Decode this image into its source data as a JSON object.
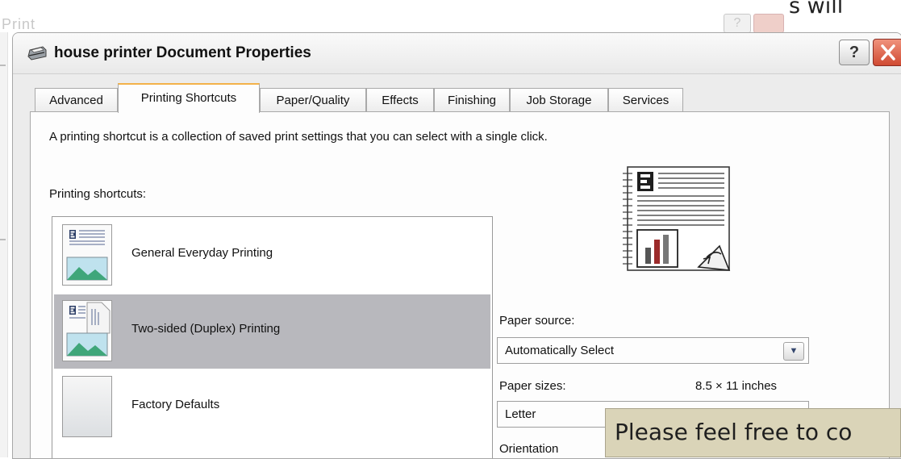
{
  "background_window": {
    "title_fragment": "Print",
    "help_label": "?",
    "right_text_fragment": "s will"
  },
  "dialog": {
    "title": "house printer Document Properties",
    "help_label": "?",
    "icon": "printer-icon"
  },
  "tabs": [
    {
      "label": "Advanced"
    },
    {
      "label": "Printing Shortcuts",
      "active": true
    },
    {
      "label": "Paper/Quality"
    },
    {
      "label": "Effects"
    },
    {
      "label": "Finishing"
    },
    {
      "label": "Job Storage"
    },
    {
      "label": "Services"
    }
  ],
  "panel": {
    "description": "A printing shortcut is a collection of saved print settings that you can select with a single click.",
    "shortcuts_label": "Printing shortcuts:",
    "shortcuts": [
      {
        "label": "General Everyday Printing",
        "icon": "document-landscape-icon",
        "selected": false
      },
      {
        "label": "Two-sided (Duplex) Printing",
        "icon": "duplex-document-icon",
        "selected": true
      },
      {
        "label": "Factory Defaults",
        "icon": "blank-page-icon",
        "selected": false
      }
    ],
    "preview_icon": "document-preview-icon",
    "paper_source": {
      "label": "Paper source:",
      "value": "Automatically Select"
    },
    "paper_sizes": {
      "label": "Paper sizes:",
      "size_text": "8.5 × 11 inches",
      "value": "Letter"
    },
    "orientation_label": "Orientation"
  },
  "overlay_caption": "Please feel free to co",
  "colors": {
    "selected_row": "#b8b8bd",
    "active_tab_accent": "#f3b24a",
    "close_button": "#d04a32",
    "caption_bg": "#dad4b8"
  }
}
